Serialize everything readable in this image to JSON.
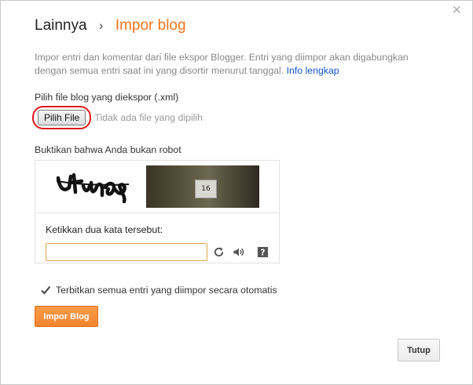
{
  "dialog": {
    "close_glyph": "×",
    "breadcrumb_parent": "Lainnya",
    "breadcrumb_separator": "›",
    "breadcrumb_current": "Impor blog"
  },
  "description": {
    "text": "Impor entri dan komentar dari file ekspor Blogger. Entri yang diimpor akan digabungkan dengan semua entri saat ini yang disortir menurut tanggal.",
    "link": "Info lengkap"
  },
  "file": {
    "label": "Pilih file blog yang diekspor (.xml)",
    "button_label": "Pilih File",
    "status": "Tidak ada file yang dipilih"
  },
  "captcha": {
    "label": "Buktikan bahwa Anda bukan robot",
    "photo_number": "16",
    "prompt": "Ketikkan dua kata tersebut:",
    "input_value": "",
    "icons": [
      "refresh-icon",
      "audio-icon",
      "help-icon"
    ]
  },
  "options": {
    "auto_publish_label": "Terbitkan semua entri yang diimpor secara otomatis",
    "auto_publish_checked": true
  },
  "buttons": {
    "import": "Impor Blog",
    "close": "Tutup"
  },
  "colors": {
    "accent": "#f4731a",
    "link": "#1155cc",
    "annotation": "#e01a1a"
  }
}
